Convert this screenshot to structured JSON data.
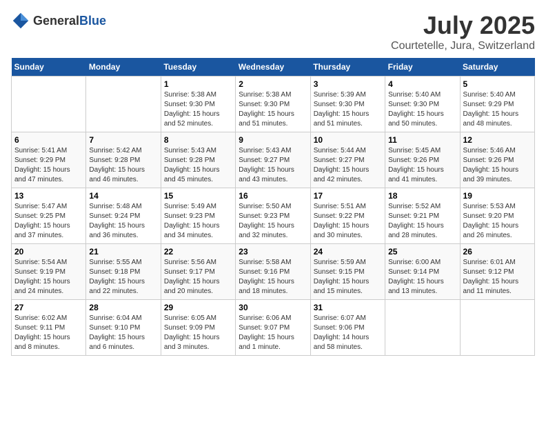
{
  "header": {
    "logo_general": "General",
    "logo_blue": "Blue",
    "month_year": "July 2025",
    "location": "Courtetelle, Jura, Switzerland"
  },
  "days_of_week": [
    "Sunday",
    "Monday",
    "Tuesday",
    "Wednesday",
    "Thursday",
    "Friday",
    "Saturday"
  ],
  "weeks": [
    {
      "cells": [
        {
          "day": "",
          "info": ""
        },
        {
          "day": "",
          "info": ""
        },
        {
          "day": "1",
          "info": "Sunrise: 5:38 AM\nSunset: 9:30 PM\nDaylight: 15 hours and 52 minutes."
        },
        {
          "day": "2",
          "info": "Sunrise: 5:38 AM\nSunset: 9:30 PM\nDaylight: 15 hours and 51 minutes."
        },
        {
          "day": "3",
          "info": "Sunrise: 5:39 AM\nSunset: 9:30 PM\nDaylight: 15 hours and 51 minutes."
        },
        {
          "day": "4",
          "info": "Sunrise: 5:40 AM\nSunset: 9:30 PM\nDaylight: 15 hours and 50 minutes."
        },
        {
          "day": "5",
          "info": "Sunrise: 5:40 AM\nSunset: 9:29 PM\nDaylight: 15 hours and 48 minutes."
        }
      ]
    },
    {
      "cells": [
        {
          "day": "6",
          "info": "Sunrise: 5:41 AM\nSunset: 9:29 PM\nDaylight: 15 hours and 47 minutes."
        },
        {
          "day": "7",
          "info": "Sunrise: 5:42 AM\nSunset: 9:28 PM\nDaylight: 15 hours and 46 minutes."
        },
        {
          "day": "8",
          "info": "Sunrise: 5:43 AM\nSunset: 9:28 PM\nDaylight: 15 hours and 45 minutes."
        },
        {
          "day": "9",
          "info": "Sunrise: 5:43 AM\nSunset: 9:27 PM\nDaylight: 15 hours and 43 minutes."
        },
        {
          "day": "10",
          "info": "Sunrise: 5:44 AM\nSunset: 9:27 PM\nDaylight: 15 hours and 42 minutes."
        },
        {
          "day": "11",
          "info": "Sunrise: 5:45 AM\nSunset: 9:26 PM\nDaylight: 15 hours and 41 minutes."
        },
        {
          "day": "12",
          "info": "Sunrise: 5:46 AM\nSunset: 9:26 PM\nDaylight: 15 hours and 39 minutes."
        }
      ]
    },
    {
      "cells": [
        {
          "day": "13",
          "info": "Sunrise: 5:47 AM\nSunset: 9:25 PM\nDaylight: 15 hours and 37 minutes."
        },
        {
          "day": "14",
          "info": "Sunrise: 5:48 AM\nSunset: 9:24 PM\nDaylight: 15 hours and 36 minutes."
        },
        {
          "day": "15",
          "info": "Sunrise: 5:49 AM\nSunset: 9:23 PM\nDaylight: 15 hours and 34 minutes."
        },
        {
          "day": "16",
          "info": "Sunrise: 5:50 AM\nSunset: 9:23 PM\nDaylight: 15 hours and 32 minutes."
        },
        {
          "day": "17",
          "info": "Sunrise: 5:51 AM\nSunset: 9:22 PM\nDaylight: 15 hours and 30 minutes."
        },
        {
          "day": "18",
          "info": "Sunrise: 5:52 AM\nSunset: 9:21 PM\nDaylight: 15 hours and 28 minutes."
        },
        {
          "day": "19",
          "info": "Sunrise: 5:53 AM\nSunset: 9:20 PM\nDaylight: 15 hours and 26 minutes."
        }
      ]
    },
    {
      "cells": [
        {
          "day": "20",
          "info": "Sunrise: 5:54 AM\nSunset: 9:19 PM\nDaylight: 15 hours and 24 minutes."
        },
        {
          "day": "21",
          "info": "Sunrise: 5:55 AM\nSunset: 9:18 PM\nDaylight: 15 hours and 22 minutes."
        },
        {
          "day": "22",
          "info": "Sunrise: 5:56 AM\nSunset: 9:17 PM\nDaylight: 15 hours and 20 minutes."
        },
        {
          "day": "23",
          "info": "Sunrise: 5:58 AM\nSunset: 9:16 PM\nDaylight: 15 hours and 18 minutes."
        },
        {
          "day": "24",
          "info": "Sunrise: 5:59 AM\nSunset: 9:15 PM\nDaylight: 15 hours and 15 minutes."
        },
        {
          "day": "25",
          "info": "Sunrise: 6:00 AM\nSunset: 9:14 PM\nDaylight: 15 hours and 13 minutes."
        },
        {
          "day": "26",
          "info": "Sunrise: 6:01 AM\nSunset: 9:12 PM\nDaylight: 15 hours and 11 minutes."
        }
      ]
    },
    {
      "cells": [
        {
          "day": "27",
          "info": "Sunrise: 6:02 AM\nSunset: 9:11 PM\nDaylight: 15 hours and 8 minutes."
        },
        {
          "day": "28",
          "info": "Sunrise: 6:04 AM\nSunset: 9:10 PM\nDaylight: 15 hours and 6 minutes."
        },
        {
          "day": "29",
          "info": "Sunrise: 6:05 AM\nSunset: 9:09 PM\nDaylight: 15 hours and 3 minutes."
        },
        {
          "day": "30",
          "info": "Sunrise: 6:06 AM\nSunset: 9:07 PM\nDaylight: 15 hours and 1 minute."
        },
        {
          "day": "31",
          "info": "Sunrise: 6:07 AM\nSunset: 9:06 PM\nDaylight: 14 hours and 58 minutes."
        },
        {
          "day": "",
          "info": ""
        },
        {
          "day": "",
          "info": ""
        }
      ]
    }
  ]
}
